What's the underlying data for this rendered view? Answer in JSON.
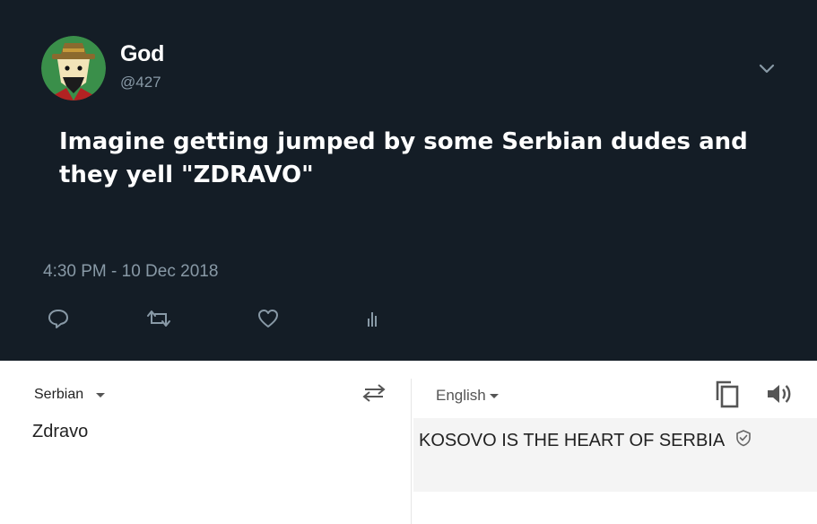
{
  "tweet": {
    "name": "God",
    "handle": "@427",
    "text": "Imagine getting jumped by some Serbian dudes and they yell \"ZDRAVO\"",
    "timestamp": "4:30 PM - 10 Dec 2018",
    "icons": {
      "avatar": "cartoon-avatar",
      "menu": "chevron-down-icon",
      "reply": "reply-icon",
      "retweet": "retweet-icon",
      "like": "heart-icon",
      "stats": "analytics-icon"
    },
    "colors": {
      "background": "#141d26",
      "muted": "#8899a6"
    }
  },
  "translator": {
    "source_language": "Serbian",
    "target_language": "English",
    "source_text": "Zdravo",
    "output_text": "KOSOVO IS THE HEART OF SERBIA",
    "icons": {
      "swap": "swap-arrows-icon",
      "copy": "copy-icon",
      "speak": "speaker-icon",
      "verified": "shield-check-icon"
    }
  }
}
